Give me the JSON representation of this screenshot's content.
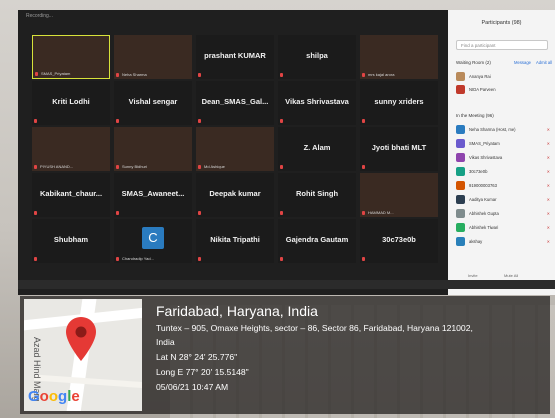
{
  "screen": {
    "recording_label": "Recording...",
    "tiles": [
      {
        "name": "SMAS_Priyatam",
        "small": true,
        "video": "vid1",
        "highlight": true
      },
      {
        "name": "Neha Sharma",
        "small": true,
        "video": "vid2"
      },
      {
        "name": "prashant KUMAR"
      },
      {
        "name": "shilpa"
      },
      {
        "name": "mrs kajal arora",
        "small": true,
        "video": "vid7"
      },
      {
        "name": "Kriti Lodhi"
      },
      {
        "name": "Vishal sengar"
      },
      {
        "name": "Dean_SMAS_Gal..."
      },
      {
        "name": "Vikas Shrivastava"
      },
      {
        "name": "sunny xriders"
      },
      {
        "name": "PIYUSH ANAND...",
        "small": true,
        "video": "vid3"
      },
      {
        "name": "Sunny Bidhuri",
        "small": true,
        "video": "vid4"
      },
      {
        "name": "Md Ashique",
        "small": true,
        "video": "vid5"
      },
      {
        "name": "Z. Alam"
      },
      {
        "name": "Jyoti bhati MLT"
      },
      {
        "name": "Kabikant_chaur..."
      },
      {
        "name": "SMAS_Awaneet..."
      },
      {
        "name": "Deepak kumar"
      },
      {
        "name": "Rohit Singh"
      },
      {
        "name": "HAMMAD M...",
        "small": true,
        "video": "vid6"
      },
      {
        "name": "Shubham"
      },
      {
        "name": "Chandradip Yad...",
        "small": true,
        "letter": "C"
      },
      {
        "name": "Nikita Tripathi"
      },
      {
        "name": "Gajendra Gautam"
      },
      {
        "name": "30c73e0b"
      }
    ]
  },
  "participants_panel": {
    "title": "Participants (98)",
    "search_placeholder": "Find a participant",
    "waiting_room": "Waiting Room (2)",
    "message_button": "Message",
    "admit_all_button": "Admit all",
    "waiting": [
      "Ananya Rai",
      "NIDA Parveen"
    ],
    "in_meeting": "In the Meeting (96)",
    "members": [
      "Neha Sharma (Host, me)",
      "SMAS_Priyatam",
      "Vikas Shrivastava",
      "30c73e0b",
      "919000003763",
      "Aaditya Kumar",
      "Abhishek Gupta",
      "Abhishek Tiwari",
      "akshay"
    ],
    "invite_label": "Invite",
    "mute_all_label": "Mute All"
  },
  "geotag": {
    "map_road_label": "Azad Hind Marg",
    "map_logo": "Google",
    "city": "Faridabad, Haryana, India",
    "address": "Tuntex – 905, Omaxe Heights, sector – 86, Sector 86, Faridabad, Haryana 121002,",
    "country": "India",
    "lat": "Lat N 28° 24' 25.776\"",
    "long": "Long E 77° 20' 15.5148\"",
    "datetime": "05/06/21 10:47 AM",
    "colors": {
      "pin": "#e53935",
      "overlay": "#1e1c1a"
    }
  }
}
